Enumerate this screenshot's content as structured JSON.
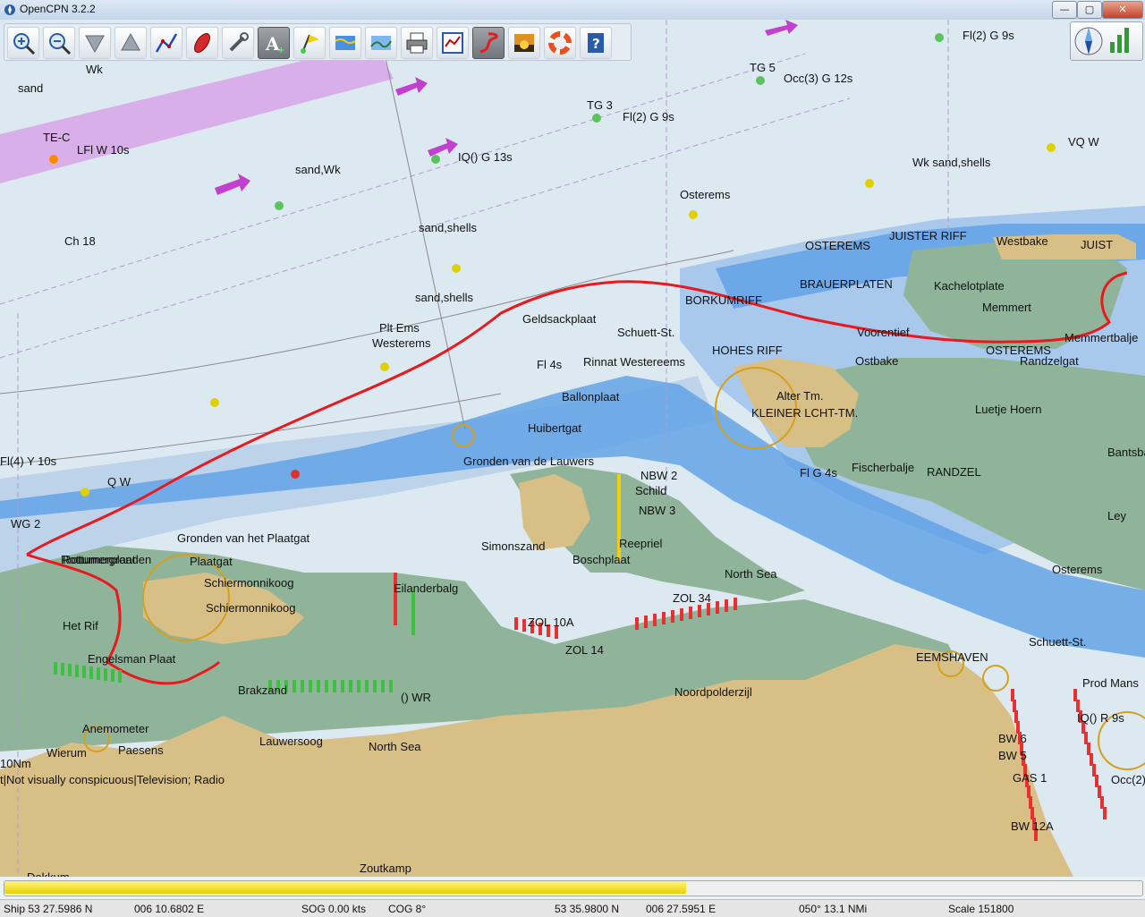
{
  "window": {
    "title": "OpenCPN 3.2.2",
    "min_label": "—",
    "max_label": "▢",
    "close_label": "✕"
  },
  "toolbar": {
    "tools": [
      {
        "name": "zoom-in",
        "icon": "zoom-in-icon"
      },
      {
        "name": "zoom-out",
        "icon": "zoom-out-icon"
      },
      {
        "name": "scale-in",
        "icon": "scale-in-icon"
      },
      {
        "name": "scale-out",
        "icon": "scale-out-icon"
      },
      {
        "name": "route",
        "icon": "route-icon"
      },
      {
        "name": "follow",
        "icon": "ship-icon"
      },
      {
        "name": "settings",
        "icon": "wrench-icon"
      },
      {
        "name": "text",
        "icon": "text-icon",
        "active": true
      },
      {
        "name": "mark",
        "icon": "flag-icon"
      },
      {
        "name": "current",
        "icon": "current-icon"
      },
      {
        "name": "tide",
        "icon": "tide-icon"
      },
      {
        "name": "print",
        "icon": "print-icon"
      },
      {
        "name": "route-manager",
        "icon": "route-manager-icon"
      },
      {
        "name": "track",
        "icon": "track-icon",
        "active": true
      },
      {
        "name": "color-scheme",
        "icon": "sunset-icon"
      },
      {
        "name": "mob",
        "icon": "lifebuoy-icon"
      },
      {
        "name": "help",
        "icon": "help-icon"
      }
    ]
  },
  "colors": {
    "deep": "#dde9f1",
    "shallow": "#a8c8ec",
    "drying": "#8fb49a",
    "land": "#d8bf86",
    "channel": "#5da0e6",
    "track": "#e8191f"
  },
  "chart_labels": [
    {
      "t": "sand"
    },
    {
      "t": "Wk"
    },
    {
      "t": "TE-C"
    },
    {
      "t": "LFl W 10s"
    },
    {
      "t": "IQ() G 13s"
    },
    {
      "t": "sand,Wk"
    },
    {
      "t": "sand,shells"
    },
    {
      "t": "Ch 18"
    },
    {
      "t": "Plt Ems"
    },
    {
      "t": "Westerems"
    },
    {
      "t": "sand,shells"
    },
    {
      "t": "Fl(2) G 9s"
    },
    {
      "t": "TG 3"
    },
    {
      "t": "TG 5"
    },
    {
      "t": "Occ(3) G 12s"
    },
    {
      "t": "VQ W"
    },
    {
      "t": "Wk sand,shells"
    },
    {
      "t": "Osterems"
    },
    {
      "t": "OSTEREMS"
    },
    {
      "t": "JUISTER RIFF"
    },
    {
      "t": "Westbake"
    },
    {
      "t": "JUIST"
    },
    {
      "t": "BRAUERPLATEN"
    },
    {
      "t": "Kachelotplate"
    },
    {
      "t": "Memmert"
    },
    {
      "t": "BORKUMRIFF"
    },
    {
      "t": "Geldsackplaat"
    },
    {
      "t": "Schuett-St."
    },
    {
      "t": "HOHES RIFF"
    },
    {
      "t": "Voorentief"
    },
    {
      "t": "OSTEREMS"
    },
    {
      "t": "Memmertbalje"
    },
    {
      "t": "Ostbake"
    },
    {
      "t": "Randzelgat"
    },
    {
      "t": "Alter Tm."
    },
    {
      "t": "KLEINER LCHT-TM."
    },
    {
      "t": "Luetje Hoern"
    },
    {
      "t": "Ballonplaat"
    },
    {
      "t": "Huibertgat"
    },
    {
      "t": "Fischerbalje"
    },
    {
      "t": "RANDZEL"
    },
    {
      "t": "Gronden van de Lauwers"
    },
    {
      "t": "Gronden van het Plaatgat"
    },
    {
      "t": "Plaatgat"
    },
    {
      "t": "Schiermonnikoog"
    },
    {
      "t": "Schiermonnikoog"
    },
    {
      "t": "Engelsman Plaat"
    },
    {
      "t": "Brakzand"
    },
    {
      "t": "Eilanderbalg"
    },
    {
      "t": "Simonszand"
    },
    {
      "t": "Rottumerplaat"
    },
    {
      "t": "Boschplaat"
    },
    {
      "t": "North Sea"
    },
    {
      "t": "North Sea"
    },
    {
      "t": "ZOL 10A"
    },
    {
      "t": "ZOL 14"
    },
    {
      "t": "ZOL 34"
    },
    {
      "t": "Noordpolderzijl"
    },
    {
      "t": "EEMSHAVEN"
    },
    {
      "t": "Schuett-St."
    },
    {
      "t": "Osterems"
    },
    {
      "t": "Prod Mans"
    },
    {
      "t": "Lauwersoog"
    },
    {
      "t": "Anemometer"
    },
    {
      "t": "Wierum"
    },
    {
      "t": "Paesens"
    },
    {
      "t": "Dokkum"
    },
    {
      "t": "Zoutkamp"
    },
    {
      "t": "10Nm"
    },
    {
      "t": "() WR"
    },
    {
      "t": "Q W"
    },
    {
      "t": "Fl(4) Y 10s"
    },
    {
      "t": "Het Rif"
    },
    {
      "t": "WG 2"
    },
    {
      "t": "Rottumergronden"
    },
    {
      "t": "Reepriel"
    },
    {
      "t": "Schild"
    },
    {
      "t": "NBW 2"
    },
    {
      "t": "NBW 3"
    },
    {
      "t": "Fl G 4s"
    },
    {
      "t": "Fl 4s"
    },
    {
      "t": "Rinnat Westereems"
    },
    {
      "t": "IQ() R 9s"
    },
    {
      "t": "BW 6"
    },
    {
      "t": "BW 5"
    },
    {
      "t": "GAS 1"
    },
    {
      "t": "BW 12A"
    },
    {
      "t": "Ley"
    },
    {
      "t": "Bantsbalje"
    },
    {
      "t": "Occ(2)"
    },
    {
      "t": "Fl(2) G 9s"
    },
    {
      "t": "t|Not visually conspicuous|Television; Radio"
    }
  ],
  "status": {
    "ship": "Ship 53 27.5986 N",
    "ship_lon": "006 10.6802 E",
    "sog": "SOG 0.00 kts",
    "cog": "COG  8°",
    "cursor_lat": "53 35.9800 N",
    "cursor_lon": "006 27.5951 E",
    "brg": "050°  13.1 NMi",
    "scale": "Scale 151800"
  },
  "progress": {
    "fraction": 0.6
  }
}
